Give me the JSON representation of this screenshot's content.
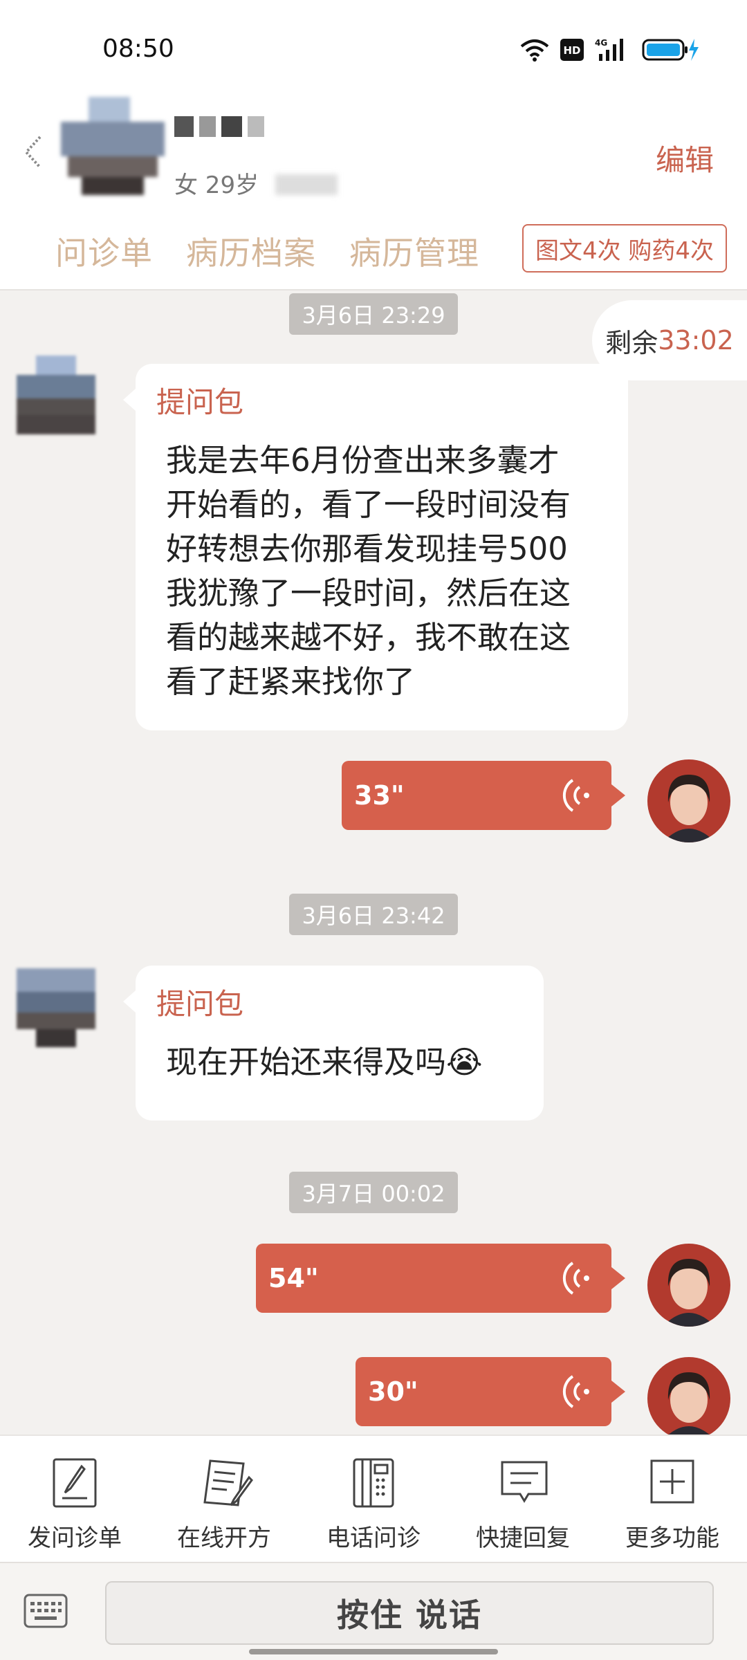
{
  "status_bar": {
    "time": "08:50",
    "hd": "HD",
    "net": "4G"
  },
  "header": {
    "patient_info": "女 29岁",
    "edit_label": "编辑",
    "tabs": [
      "问诊单",
      "病历档案",
      "病历管理"
    ],
    "quota": "图文4次 购药4次"
  },
  "chat": {
    "remaining_label": "剩余",
    "remaining_value": "33:02",
    "messages": [
      {
        "time": "3月6日 23:29",
        "title": "提问包",
        "text": [
          "我是去年6月份查出来多囊才",
          "开始看的，看了一段时间没有",
          "好转想去你那看发现挂号500",
          "我犹豫了一段时间，然后在这",
          "看的越来越不好，我不敢在这",
          "看了赶紧来找你了"
        ]
      },
      {
        "voice": "33\""
      },
      {
        "time": "3月6日 23:42",
        "title": "提问包",
        "text": [
          "现在开始还来得及吗😭"
        ]
      },
      {
        "time": "3月7日 00:02"
      },
      {
        "voice": "54\""
      },
      {
        "voice": "30\""
      }
    ]
  },
  "toolbar": {
    "items": [
      {
        "label": "发问诊单",
        "icon": "form-icon"
      },
      {
        "label": "在线开方",
        "icon": "prescription-icon"
      },
      {
        "label": "电话问诊",
        "icon": "phone-icon"
      },
      {
        "label": "快捷回复",
        "icon": "quick-reply-icon"
      },
      {
        "label": "更多功能",
        "icon": "plus-icon"
      }
    ]
  },
  "input": {
    "talk_label": "按住 说话"
  },
  "colors": {
    "accent": "#c9634f",
    "voice_bubble": "#d6604c",
    "tab_text": "#d5b79a"
  }
}
